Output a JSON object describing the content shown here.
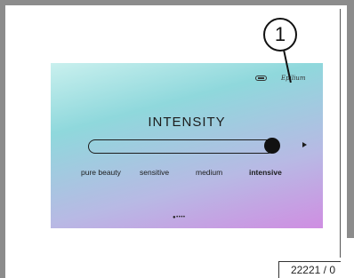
{
  "screen": {
    "title": "INTENSITY",
    "logo_text": "Epilium",
    "slider_level": 1.0,
    "levels": [
      {
        "label": "pure beauty",
        "active": false
      },
      {
        "label": "sensitive",
        "active": false
      },
      {
        "label": "medium",
        "active": false
      },
      {
        "label": "intensive",
        "active": true
      }
    ],
    "pager_dots": "●••••",
    "colors": {
      "gradient_top": "#c9f0ee",
      "gradient_mid": "#8fd8dc",
      "gradient_bottom": "#cf8ee2"
    }
  },
  "callout": {
    "number": "1"
  },
  "reference": {
    "code": "22221 / 0"
  }
}
